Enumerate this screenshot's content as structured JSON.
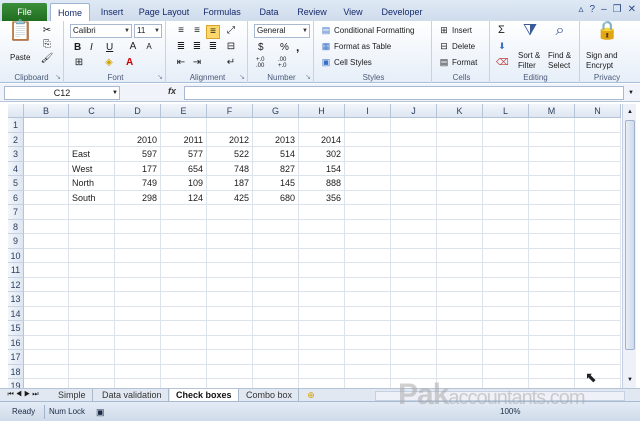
{
  "ribbon_tabs": {
    "file": "File",
    "home": "Home",
    "insert": "Insert",
    "page_layout": "Page Layout",
    "formulas": "Formulas",
    "data": "Data",
    "review": "Review",
    "view": "View",
    "developer": "Developer"
  },
  "clipboard": {
    "paste": "Paste",
    "label": "Clipboard"
  },
  "font": {
    "name": "Calibri",
    "size": "11",
    "bold": "B",
    "italic": "I",
    "underline": "U",
    "font_color": "A",
    "label": "Font"
  },
  "alignment": {
    "label": "Alignment"
  },
  "number": {
    "format": "General",
    "currency": "$",
    "percent": "%",
    "comma": ",",
    "inc": "+.0 .00",
    "dec": ".00 +.0",
    "label": "Number"
  },
  "styles": {
    "conditional": "Conditional Formatting",
    "format_table": "Format as Table",
    "cell_styles": "Cell Styles",
    "label": "Styles"
  },
  "cells": {
    "insert": "Insert",
    "delete": "Delete",
    "format": "Format",
    "label": "Cells"
  },
  "editing": {
    "sum": "Σ",
    "sort_filter_1": "Sort &",
    "sort_filter_2": "Filter",
    "find_select_1": "Find &",
    "find_select_2": "Select",
    "label": "Editing"
  },
  "privacy": {
    "sign_1": "Sign and",
    "sign_2": "Encrypt",
    "label": "Privacy"
  },
  "formula_bar": {
    "name_box": "C12",
    "fx": "fx",
    "value": ""
  },
  "columns": [
    "B",
    "C",
    "D",
    "E",
    "F",
    "G",
    "H",
    "I",
    "J",
    "K",
    "L",
    "M",
    "N"
  ],
  "rows": [
    "1",
    "2",
    "3",
    "4",
    "5",
    "6",
    "7",
    "8",
    "9",
    "10",
    "11",
    "12",
    "13",
    "14",
    "15",
    "16",
    "17",
    "18",
    "19"
  ],
  "table": {
    "years": [
      "2010",
      "2011",
      "2012",
      "2013",
      "2014"
    ],
    "data": [
      {
        "label": "East",
        "values": [
          "597",
          "577",
          "522",
          "514",
          "302"
        ]
      },
      {
        "label": "West",
        "values": [
          "177",
          "654",
          "748",
          "827",
          "154"
        ]
      },
      {
        "label": "North",
        "values": [
          "749",
          "109",
          "187",
          "145",
          "888"
        ]
      },
      {
        "label": "South",
        "values": [
          "298",
          "124",
          "425",
          "680",
          "356"
        ]
      }
    ]
  },
  "sheet_tabs": [
    "Simple",
    "Data validation",
    "Check boxes",
    "Combo box"
  ],
  "active_sheet": "Check boxes",
  "status": {
    "ready": "Ready",
    "num_lock": "Num Lock",
    "zoom": "100%"
  },
  "watermark": {
    "brand": "Pak",
    "rest": "accountants.com"
  }
}
